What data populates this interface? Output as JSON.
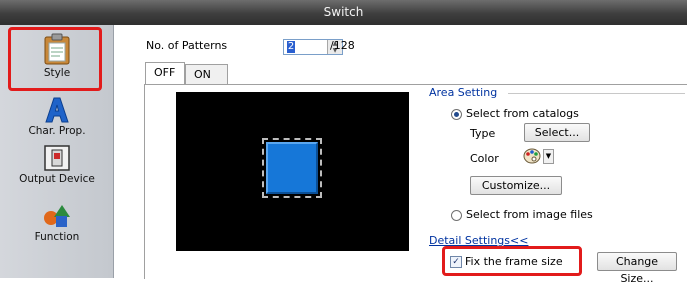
{
  "window": {
    "title": "Switch"
  },
  "sidebar": {
    "items": [
      {
        "label": "Style",
        "icon": "clipboard-icon",
        "selected": true
      },
      {
        "label": "Char. Prop.",
        "icon": "letter-a-icon"
      },
      {
        "label": "Output Device",
        "icon": "output-device-icon"
      },
      {
        "label": "Function",
        "icon": "shapes-icon"
      }
    ]
  },
  "patterns": {
    "label": "No. of Patterns",
    "value": "2",
    "max": "/128"
  },
  "tabs": [
    {
      "label": "OFF",
      "active": true
    },
    {
      "label": "ON",
      "active": false
    }
  ],
  "area_setting": {
    "title": "Area Setting",
    "catalog_option": "Select from catalogs",
    "type_label": "Type",
    "select_button": "Select...",
    "color_label": "Color",
    "customize_button": "Customize...",
    "image_option": "Select from image files"
  },
  "detail": {
    "link": "Detail Settings<<",
    "fix_frame": "Fix the frame size",
    "fix_frame_checked": true,
    "change_size_button": "Change Size..."
  },
  "colors": {
    "highlight": "#e21b1b",
    "switch_face": "#1677d8",
    "preview_bg": "#000000",
    "group_title": "#0033a0"
  }
}
